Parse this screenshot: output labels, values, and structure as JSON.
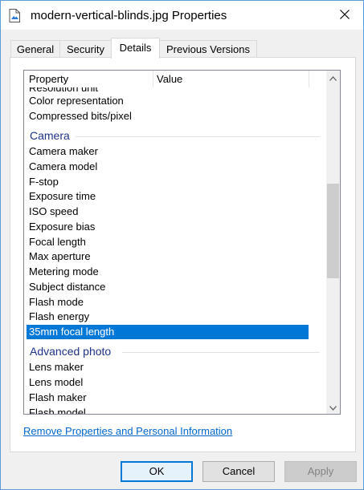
{
  "window": {
    "title": "modern-vertical-blinds.jpg Properties"
  },
  "tabs": [
    {
      "label": "General"
    },
    {
      "label": "Security"
    },
    {
      "label": "Details"
    },
    {
      "label": "Previous Versions"
    }
  ],
  "columns": {
    "property": "Property",
    "value": "Value"
  },
  "rows_top": [
    {
      "label": "Resolution unit"
    },
    {
      "label": "Color representation"
    },
    {
      "label": "Compressed bits/pixel"
    }
  ],
  "group_camera": "Camera",
  "camera_rows": [
    {
      "label": "Camera maker"
    },
    {
      "label": "Camera model"
    },
    {
      "label": "F-stop"
    },
    {
      "label": "Exposure time"
    },
    {
      "label": "ISO speed"
    },
    {
      "label": "Exposure bias"
    },
    {
      "label": "Focal length"
    },
    {
      "label": "Max aperture"
    },
    {
      "label": "Metering mode"
    },
    {
      "label": "Subject distance"
    },
    {
      "label": "Flash mode"
    },
    {
      "label": "Flash energy"
    },
    {
      "label": "35mm focal length"
    }
  ],
  "group_advanced": "Advanced photo",
  "advanced_rows": [
    {
      "label": "Lens maker"
    },
    {
      "label": "Lens model"
    },
    {
      "label": "Flash maker"
    },
    {
      "label": "Flash model"
    }
  ],
  "remove_link": "Remove Properties and Personal Information",
  "buttons": {
    "ok": "OK",
    "cancel": "Cancel",
    "apply": "Apply"
  },
  "colors": {
    "selection": "#0078d7",
    "group_text": "#1e3287",
    "link": "#0066cc"
  }
}
